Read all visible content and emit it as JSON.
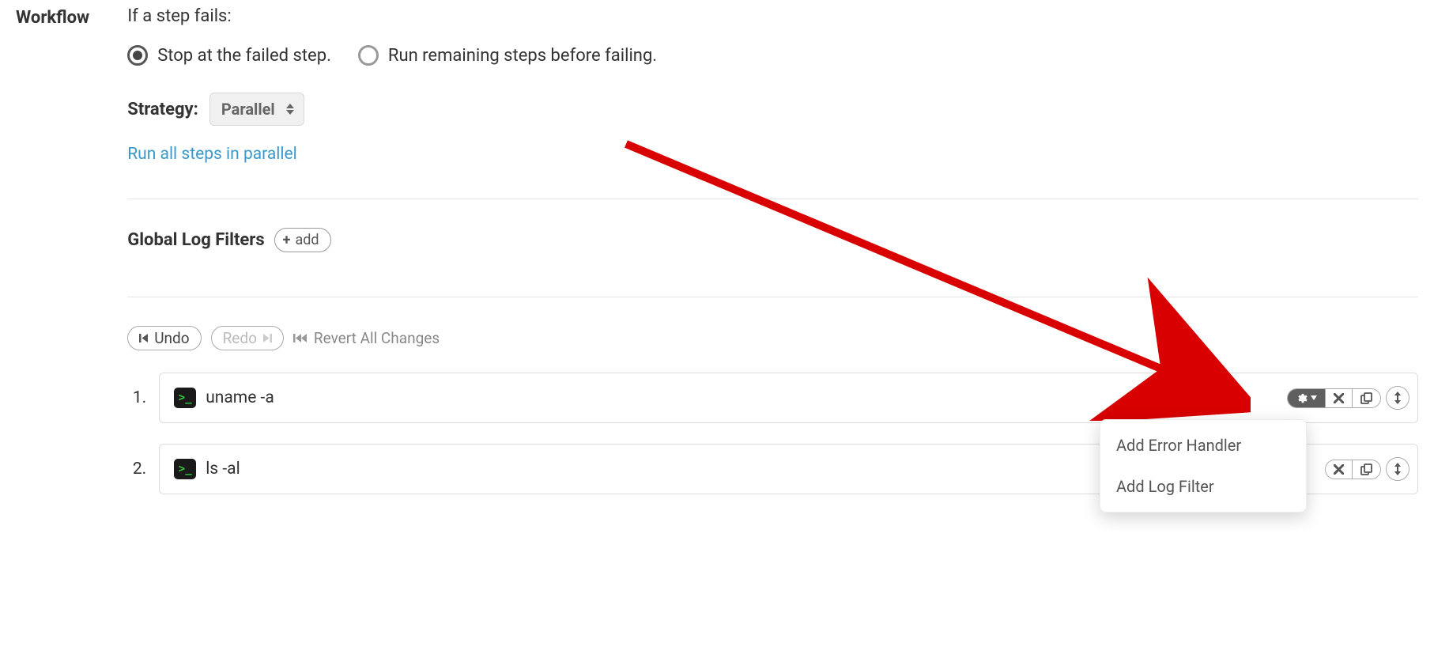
{
  "section_label": "Workflow",
  "fail_title": "If a step fails:",
  "radios": {
    "stop": "Stop at the failed step.",
    "run_remaining": "Run remaining steps before failing."
  },
  "strategy_label": "Strategy:",
  "strategy_value": "Parallel",
  "parallel_link": "Run all steps in parallel",
  "global_log_filters_label": "Global Log Filters",
  "add_button": "add",
  "undo": "Undo",
  "redo": "Redo",
  "revert": "Revert All Changes",
  "steps": [
    {
      "num": "1.",
      "cmd": "uname -a"
    },
    {
      "num": "2.",
      "cmd": "ls -al"
    }
  ],
  "menu": {
    "add_error_handler": "Add Error Handler",
    "add_log_filter": "Add Log Filter"
  }
}
